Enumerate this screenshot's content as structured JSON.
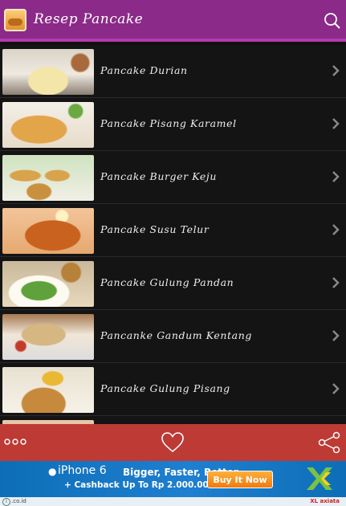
{
  "appbar": {
    "title": "Resep Pancake"
  },
  "recipes": [
    {
      "label": "Pancake Durian"
    },
    {
      "label": "Pancake Pisang Karamel"
    },
    {
      "label": "Pancake Burger Keju"
    },
    {
      "label": "Pancake Susu Telur"
    },
    {
      "label": "Pancake Gulung Pandan"
    },
    {
      "label": "Pancanke Gandum Kentang"
    },
    {
      "label": "Pancake Gulung Pisang"
    }
  ],
  "ad": {
    "product": "iPhone 6",
    "tagline": "Bigger, Faster, Better",
    "cashback": "Cashback Up To Rp 2.000.000",
    "button": "Buy It Now",
    "footer_left": ".co.id",
    "footer_right": "XL axiata"
  },
  "colors": {
    "appbar": "#8b2a88",
    "toolbar": "#bd3a35",
    "ad": "#1f7fd0"
  }
}
